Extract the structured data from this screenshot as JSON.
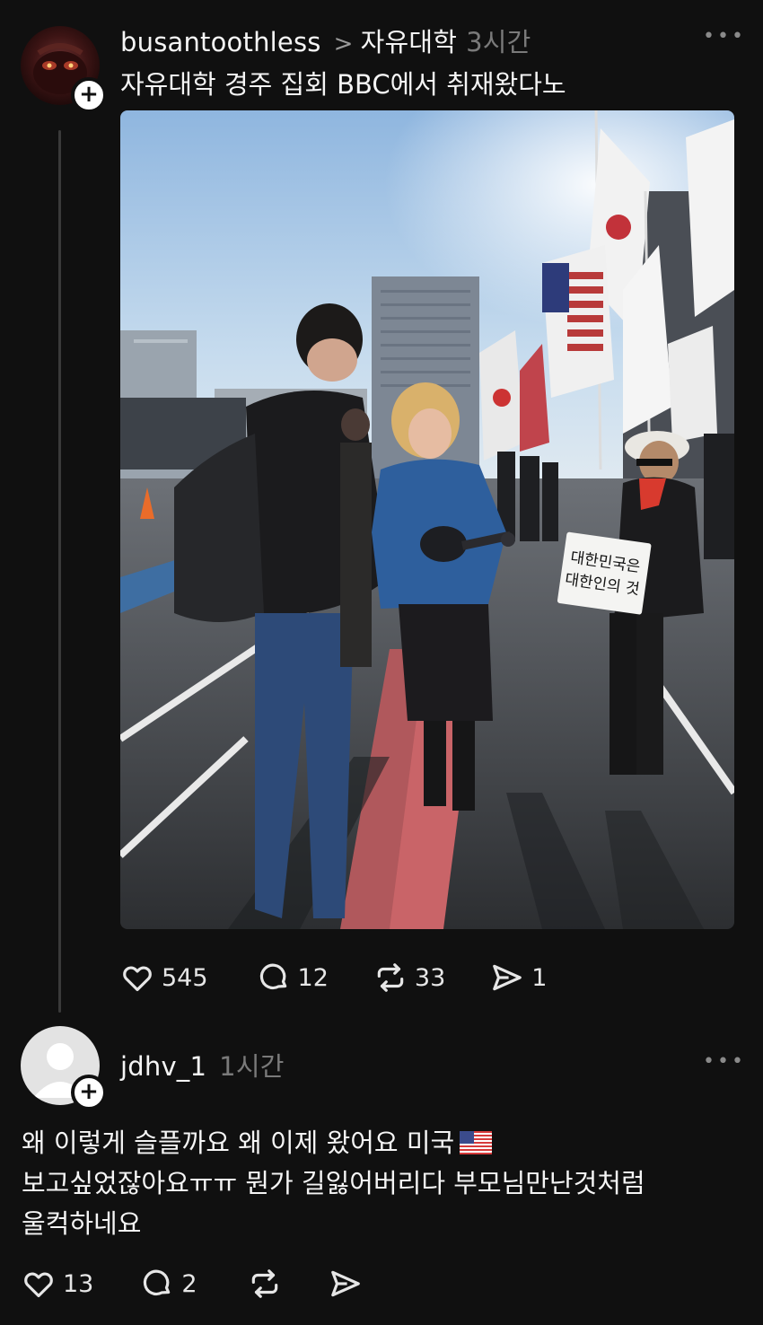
{
  "post": {
    "username": "busantoothless",
    "community": "자유대학",
    "time": "3시간",
    "title": "자유대학 경주 집회 BBC에서 취재왔다노",
    "more": "•••",
    "photo_sign_text_1": "대한민국은",
    "photo_sign_text_2": "대한인의 것",
    "likes": "545",
    "comments": "12",
    "reposts": "33",
    "shares": "1"
  },
  "reply": {
    "username": "jdhv_1",
    "time": "1시간",
    "more": "•••",
    "line1": "왜 이렇게 슬플까요 왜 이제 왔어요 미국",
    "line2": "보고싶었잖아요ㅠㅠ 뭔가 길잃어버리다 부모님만난것처럼",
    "line3": "울컥하네요",
    "likes": "13",
    "comments": "2"
  },
  "icons": {
    "avatar_plus": "plus-icon",
    "breadcrumb": "chevron-right-icon",
    "like": "heart-icon",
    "comment": "comment-bubble-icon",
    "repost": "repost-icon",
    "share": "send-icon",
    "flag": "us-flag-icon"
  }
}
